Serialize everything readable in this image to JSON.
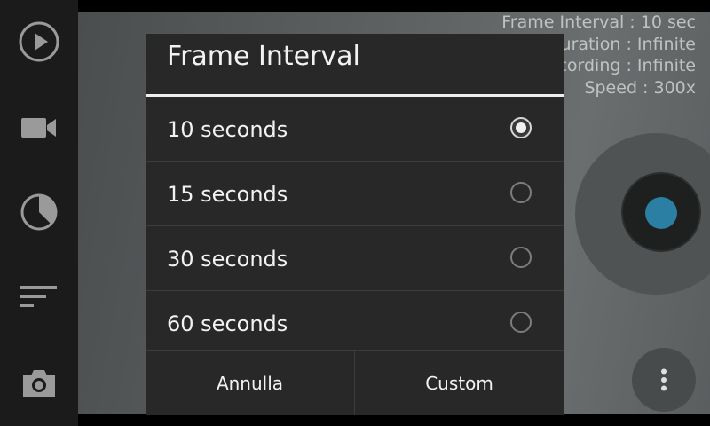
{
  "sidebar": {
    "items": [
      {
        "name": "play-icon"
      },
      {
        "name": "video-camera-icon"
      },
      {
        "name": "timer-pie-icon"
      },
      {
        "name": "sort-lines-icon"
      },
      {
        "name": "photo-camera-icon"
      }
    ]
  },
  "info": {
    "lines": [
      "Frame Interval : 10 sec",
      "uration : Infinite",
      "cording : Infinite",
      "Speed : 300x"
    ]
  },
  "dialog": {
    "title": "Frame Interval",
    "options": [
      {
        "label": "10 seconds",
        "selected": true
      },
      {
        "label": "15 seconds",
        "selected": false
      },
      {
        "label": "30 seconds",
        "selected": false
      },
      {
        "label": "60 seconds",
        "selected": false
      }
    ],
    "cancel_label": "Annulla",
    "custom_label": "Custom"
  },
  "colors": {
    "accent": "#2b7fa3",
    "dialog_bg": "#282828",
    "sidebar_bg": "#1b1b1b"
  },
  "icons": {
    "more": "more-vertical-icon"
  }
}
